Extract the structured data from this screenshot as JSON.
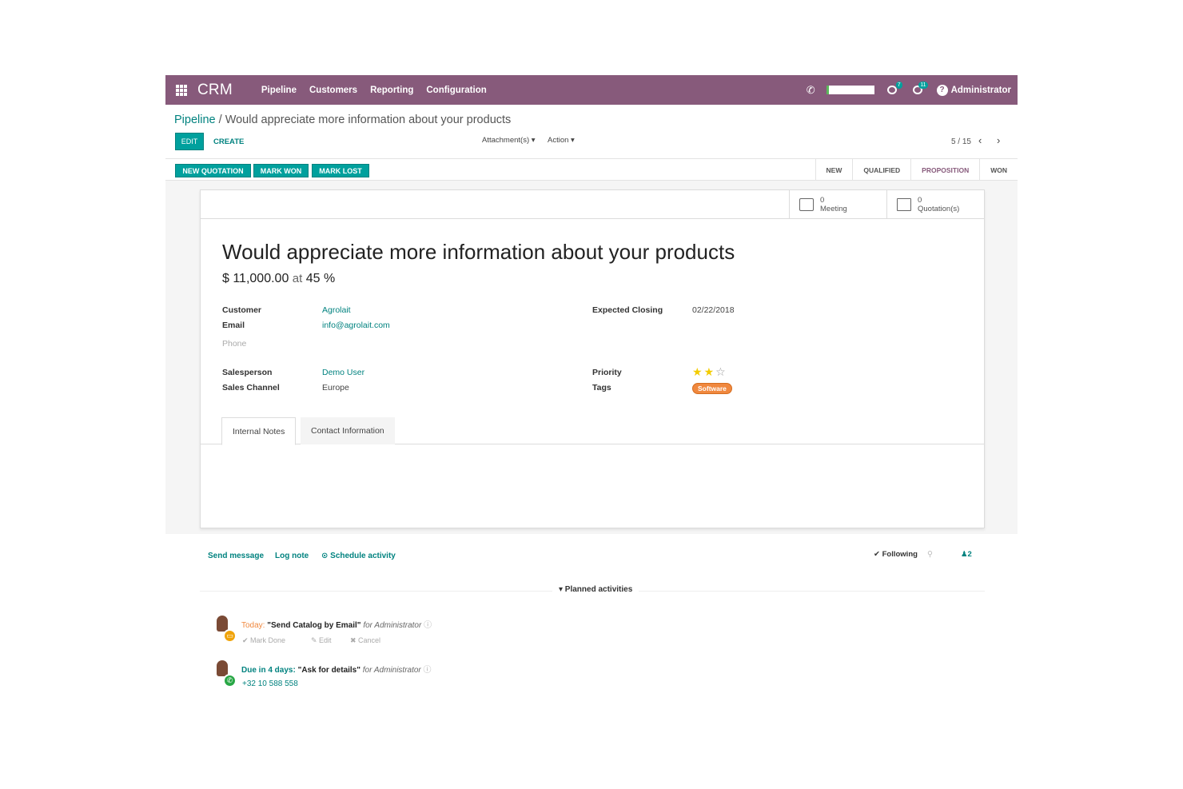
{
  "navbar": {
    "app_name": "CRM",
    "menu": [
      "Pipeline",
      "Customers",
      "Reporting",
      "Configuration"
    ],
    "user": "Administrator",
    "notif_badge_1": "7",
    "notif_badge_2": "11",
    "bg_color": "#875a7b"
  },
  "breadcrumb": {
    "parent": "Pipeline",
    "separator": "/",
    "current": "Would appreciate more information about your products"
  },
  "control": {
    "edit_label": "EDIT",
    "create_label": "CREATE",
    "attachment_label": "Attachment(s) ▾",
    "action_label": "Action ▾",
    "pager": "5 / 15"
  },
  "statusbar": {
    "buttons": [
      "NEW QUOTATION",
      "MARK WON",
      "MARK LOST"
    ],
    "stages": [
      "NEW",
      "QUALIFIED",
      "PROPOSITION",
      "WON"
    ],
    "active_stage": "PROPOSITION"
  },
  "stat_buttons": [
    {
      "count": "0",
      "label": "Meeting",
      "icon": "calendar-icon"
    },
    {
      "count": "0",
      "label": "Quotation(s)",
      "icon": "edit-icon"
    }
  ],
  "lead": {
    "title": "Would appreciate more information about your products",
    "revenue": "$ 11,000.00",
    "at": "at",
    "probability": "45 %",
    "fields_left": {
      "customer_label": "Customer",
      "customer": "Agrolait",
      "email_label": "Email",
      "email": "info@agrolait.com",
      "phone_label": "Phone",
      "salesperson_label": "Salesperson",
      "salesperson": "Demo User",
      "channel_label": "Sales Channel",
      "channel": "Europe"
    },
    "fields_right": {
      "closing_label": "Expected Closing",
      "closing": "02/22/2018",
      "priority_label": "Priority",
      "priority_stars": 2,
      "priority_max": 3,
      "tags_label": "Tags",
      "tag": "Software"
    }
  },
  "tabs": [
    "Internal Notes",
    "Contact Information"
  ],
  "chatter": {
    "send_message": "Send message",
    "log_note": "Log note",
    "schedule_activity": "⊙ Schedule activity",
    "following": "✔ Following",
    "followers_count": "2",
    "planned_header": "▾ Planned activities",
    "activities": [
      {
        "when": "Today:",
        "summary": "\"Send Catalog by Email\"",
        "for": "for Administrator",
        "actions": [
          "✔ Mark Done",
          "✎ Edit",
          "✖ Cancel"
        ],
        "icon_color": "#f0a30a"
      },
      {
        "when": "Due in 4 days:",
        "summary": "\"Ask for details\"",
        "for": "for Administrator",
        "phone": "+32 10 588 558",
        "icon_color": "#28a745"
      }
    ]
  }
}
